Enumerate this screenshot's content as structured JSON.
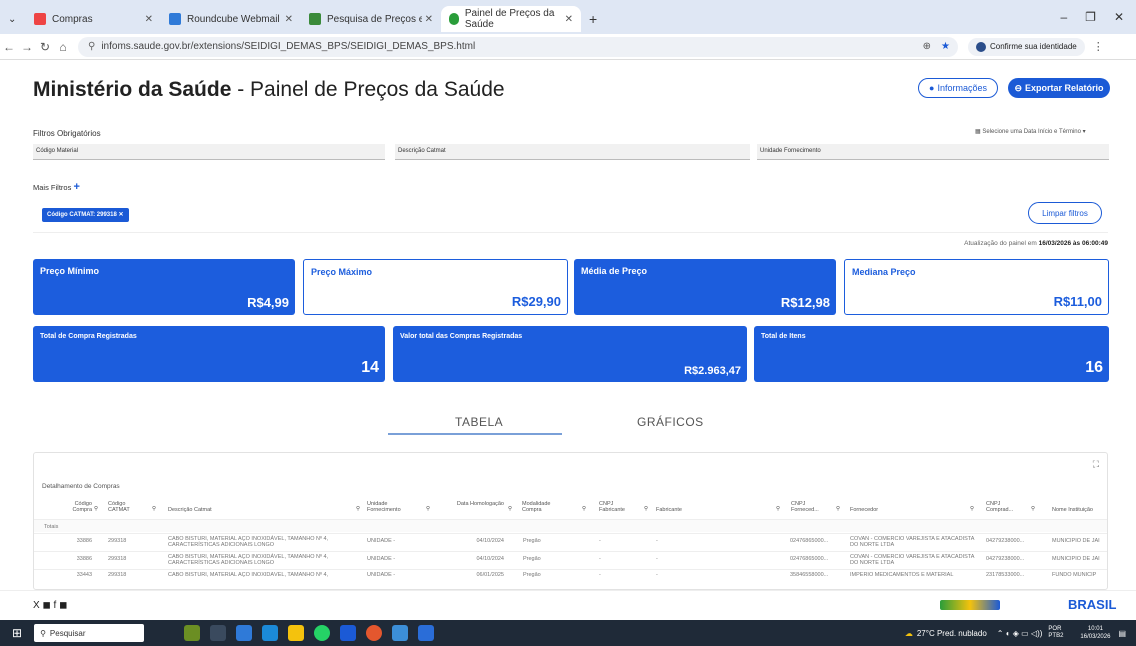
{
  "browser": {
    "tabs": [
      {
        "label": "Compras",
        "color": "#e44"
      },
      {
        "label": "Roundcube Webmail :: Caixa d",
        "color": "#2f7ad8"
      },
      {
        "label": "Pesquisa de Preços em Licitaçã",
        "color": "#3a8a3a"
      },
      {
        "label": "Painel de Preços da Saúde",
        "color": "#2a9d3a"
      }
    ],
    "url": "infoms.saude.gov.br/extensions/SEIDIGI_DEMAS_BPS/SEIDIGI_DEMAS_BPS.html",
    "identity_label": "Confirme sua identidade",
    "new_tab": "+"
  },
  "page": {
    "title_bold": "Ministério da Saúde",
    "title_rest": " - Painel de Preços da Saúde",
    "btn_info": "Informações",
    "btn_export": "Exportar Relatório",
    "filters_title": "Filtros Obrigatórios",
    "date_select": "Selecione uma Data Início e Término",
    "fields": [
      "Código Material",
      "Descrição Catmat",
      "Unidade Fornecimento"
    ],
    "more_filters": "Mais Filtros",
    "chip": "Código CATMAT: 299318",
    "clear_filters": "Limpar filtros",
    "updated_prefix": "Atualização do painel em ",
    "updated_value": "16/03/2026 às 06:00:49"
  },
  "cards": [
    {
      "label": "Preço Mínimo",
      "value": "R$4,99"
    },
    {
      "label": "Preço Máximo",
      "value": "R$29,90"
    },
    {
      "label": "Média de Preço",
      "value": "R$12,98"
    },
    {
      "label": "Mediana Preço",
      "value": "R$11,00"
    },
    {
      "label": "Total de Compra Registradas",
      "value": "14"
    },
    {
      "label": "Valor total das Compras Registradas",
      "value": "R$2.963,47"
    },
    {
      "label": "Total de Itens",
      "value": "16"
    }
  ],
  "view_tabs": {
    "tabela": "TABELA",
    "graficos": "GRÁFICOS"
  },
  "table": {
    "title": "Detalhamento de Compras",
    "headers": [
      "Código Compra",
      "Código CATMAT",
      "Descrição Catmat",
      "Unidade Fornecimento",
      "Data Homologação",
      "Modalidade Compra",
      "CNPJ Fabricante",
      "Fabricante",
      "CNPJ Forneced...",
      "Fornecedor",
      "CNPJ Comprad...",
      "Nome Instituição"
    ],
    "totals": "Totais",
    "rows": [
      [
        "33886",
        "299318",
        "CABO BISTURI, MATERIAL AÇO INOXIDÁVEL, TAMANHO Nº 4, CARACTERÍSTICAS ADICIONAIS LONGO",
        "UNIDADE -",
        "04/10/2024",
        "Pregão",
        "-",
        "-",
        "02476865000...",
        "COVAN - COMERCIO VAREJISTA E ATACADISTA DO NORTE LTDA",
        "04279238000...",
        "MUNICIPIO DE JAI"
      ],
      [
        "33886",
        "299318",
        "CABO BISTURI, MATERIAL AÇO INOXIDÁVEL, TAMANHO Nº 4, CARACTERÍSTICAS ADICIONAIS LONGO",
        "UNIDADE -",
        "04/10/2024",
        "Pregão",
        "-",
        "-",
        "02476865000...",
        "COVAN - COMERCIO VAREJISTA E ATACADISTA DO NORTE LTDA",
        "04279238000...",
        "MUNICIPIO DE JAI"
      ],
      [
        "33443",
        "299318",
        "CABO BISTURI, MATERIAL AÇO INOXIDÁVEL, TAMANHO Nº 4,",
        "UNIDADE -",
        "06/01/2025",
        "Pregão",
        "-",
        "-",
        "35846558000...",
        "IMPERIO MEDICAMENTOS E MATERIAL",
        "23178533000...",
        "FUNDO MUNICIP"
      ]
    ]
  },
  "footer": {
    "social": "X ◼ f ◼",
    "gov": "BRASIL"
  },
  "taskbar": {
    "search": "Pesquisar",
    "weather": "27°C Pred. nublado",
    "lang": "POR PTB2",
    "time": "10:01",
    "date": "16/03/2026"
  }
}
